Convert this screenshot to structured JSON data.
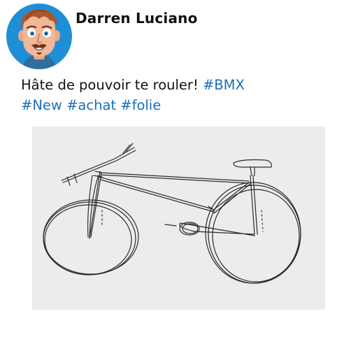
{
  "post": {
    "author": {
      "name": "Darren Luciano",
      "avatar_icon": "cartoon-man-avatar-icon",
      "avatar_bg": "#1e8fd6"
    },
    "text": {
      "line1_plain": "Hâte de pouvoir te rouler! ",
      "line1_hashtag": "#BMX",
      "line2_hashtags": [
        "#New",
        "#achat",
        "#folie"
      ]
    },
    "hashtag_color": "#1a6fb5",
    "image": {
      "subject_icon": "bicycle-sketch-icon",
      "background": "#ececec"
    }
  }
}
